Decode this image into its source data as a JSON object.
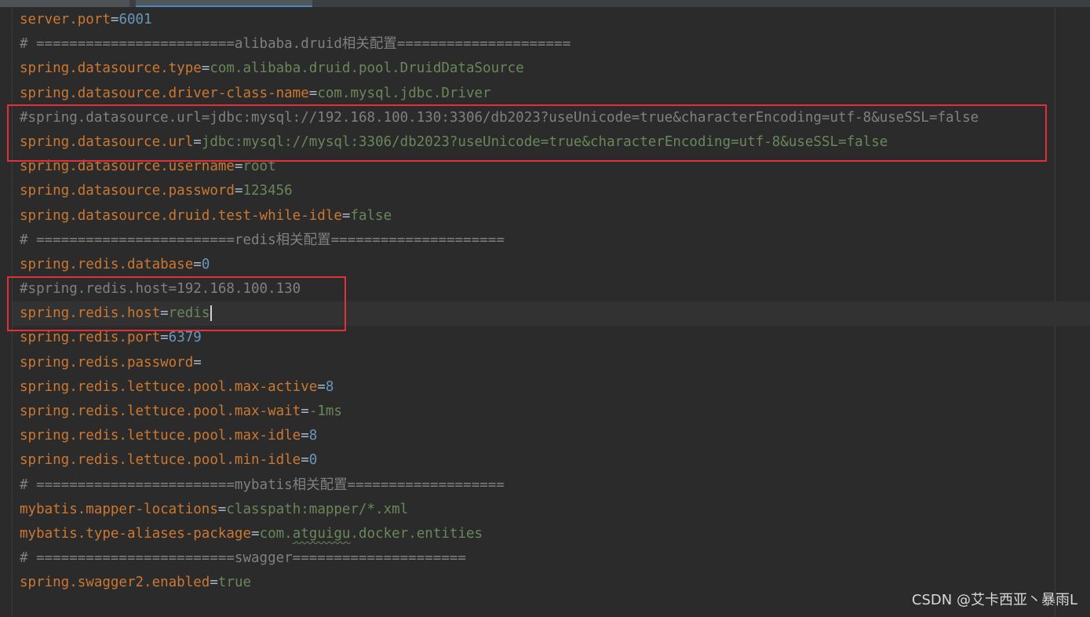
{
  "editor": {
    "lines": [
      {
        "type": "prop",
        "key": "server.port",
        "value": "6001",
        "value_kind": "num"
      },
      {
        "type": "comment",
        "text": "# ========================alibaba.druid相关配置====================="
      },
      {
        "type": "prop",
        "key": "spring.datasource.type",
        "value": "com.alibaba.druid.pool.DruidDataSource",
        "value_kind": "str"
      },
      {
        "type": "prop",
        "key": "spring.datasource.driver-class-name",
        "value": "com.mysql.jdbc.Driver",
        "value_kind": "str"
      },
      {
        "type": "comment",
        "text": "#spring.datasource.url=jdbc:mysql://192.168.100.130:3306/db2023?useUnicode=true&characterEncoding=utf-8&useSSL=false"
      },
      {
        "type": "prop",
        "key": "spring.datasource.url",
        "value": "jdbc:mysql://mysql:3306/db2023?useUnicode=true&characterEncoding=utf-8&useSSL=false",
        "value_kind": "str"
      },
      {
        "type": "prop",
        "key": "spring.datasource.username",
        "value": "root",
        "value_kind": "str"
      },
      {
        "type": "prop",
        "key": "spring.datasource.password",
        "value": "123456",
        "value_kind": "str"
      },
      {
        "type": "prop",
        "key": "spring.datasource.druid.test-while-idle",
        "value": "false",
        "value_kind": "str"
      },
      {
        "type": "comment",
        "text": "# ========================redis相关配置====================="
      },
      {
        "type": "prop",
        "key": "spring.redis.database",
        "value": "0",
        "value_kind": "num"
      },
      {
        "type": "comment",
        "text": "#spring.redis.host=192.168.100.130"
      },
      {
        "type": "prop",
        "key": "spring.redis.host",
        "value": "redis",
        "value_kind": "str",
        "caret": true
      },
      {
        "type": "prop",
        "key": "spring.redis.port",
        "value": "6379",
        "value_kind": "num"
      },
      {
        "type": "prop",
        "key": "spring.redis.password",
        "value": "",
        "value_kind": "str"
      },
      {
        "type": "prop",
        "key": "spring.redis.lettuce.pool.max-active",
        "value": "8",
        "value_kind": "num"
      },
      {
        "type": "prop",
        "key": "spring.redis.lettuce.pool.max-wait",
        "value": "-1ms",
        "value_kind": "str"
      },
      {
        "type": "prop",
        "key": "spring.redis.lettuce.pool.max-idle",
        "value": "8",
        "value_kind": "num"
      },
      {
        "type": "prop",
        "key": "spring.redis.lettuce.pool.min-idle",
        "value": "0",
        "value_kind": "num"
      },
      {
        "type": "comment",
        "text": "# ========================mybatis相关配置==================="
      },
      {
        "type": "prop",
        "key": "mybatis.mapper-locations",
        "value": "classpath:mapper/*.xml",
        "value_kind": "str"
      },
      {
        "type": "prop",
        "key": "mybatis.type-aliases-package",
        "value": "com.atguigu.docker.entities",
        "value_kind": "str",
        "squiggle_word": "atguigu"
      },
      {
        "type": "comment",
        "text": "# ========================swagger====================="
      },
      {
        "type": "prop",
        "key": "spring.swagger2.enabled",
        "value": "true",
        "value_kind": "str"
      }
    ]
  },
  "colors": {
    "background": "#2b2b2b",
    "key": "#cc7832",
    "string_value": "#6a8759",
    "number_value": "#6897bb",
    "comment": "#808080",
    "highlight_box": "#e0313a"
  },
  "watermark": {
    "text": "CSDN @艾卡西亚丶暴雨L"
  }
}
